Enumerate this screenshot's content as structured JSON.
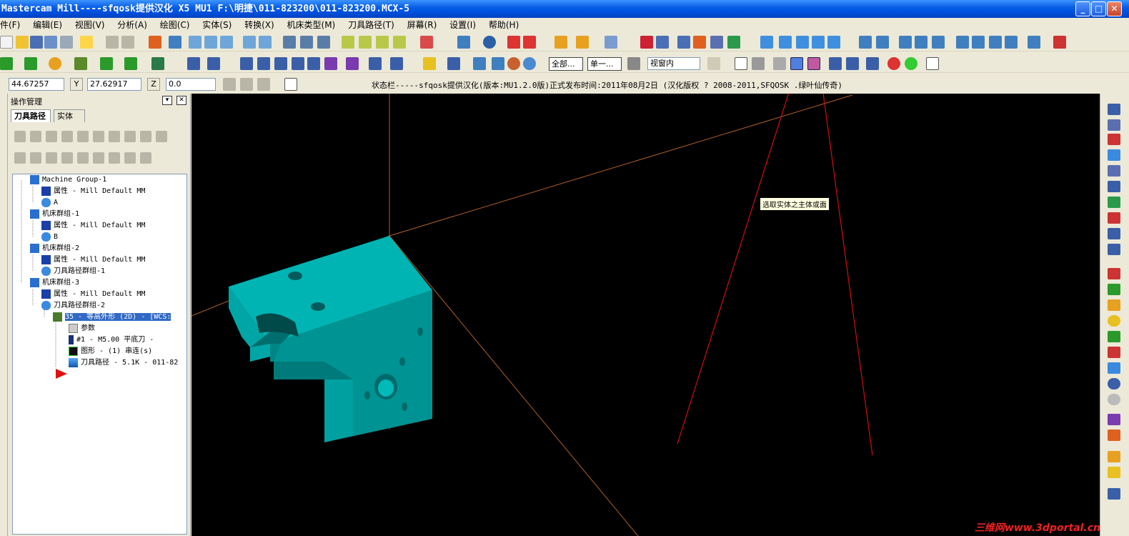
{
  "window": {
    "title": "Mastercam Mill----sfqosk提供汉化 X5 MU1  F:\\明捷\\011-823200\\011-823200.MCX-5",
    "min": "_",
    "max": "□",
    "close": "✕"
  },
  "menu": [
    "件(F)",
    "编辑(E)",
    "视图(V)",
    "分析(A)",
    "绘图(C)",
    "实体(S)",
    "转换(X)",
    "机床类型(M)",
    "刀具路径(T)",
    "屏幕(R)",
    "设置(I)",
    "帮助(H)"
  ],
  "toolbar3": {
    "all_button": "全部...",
    "single_button": "单一...",
    "view_mode": "视窗内"
  },
  "coords": {
    "x_value": "44.67257",
    "y_label": "Y",
    "y_value": "27.62917",
    "z_label": "Z",
    "z_value": "0.0"
  },
  "status_text": "状态栏-----sfqosk提供汉化(版本:MU1.2.0版)正式发布时间:2011年08月2日 (汉化版权 ? 2008-2011,SFQOSK  .绿叶仙传奇)",
  "panel": {
    "title": "操作管理",
    "tabs": [
      "刀具路径",
      "实体"
    ],
    "tree": [
      {
        "text": "Machine Group-1",
        "indent": 0,
        "icon": "machine-group-icon"
      },
      {
        "text": "属性 - Mill Default MM",
        "indent": 1,
        "icon": "properties-icon"
      },
      {
        "text": "A",
        "indent": 1,
        "icon": "toolpath-group-icon"
      },
      {
        "text": "机床群组-1",
        "indent": 0,
        "icon": "machine-group-icon"
      },
      {
        "text": "属性 - Mill Default MM",
        "indent": 1,
        "icon": "properties-icon"
      },
      {
        "text": "B",
        "indent": 1,
        "icon": "toolpath-group-icon"
      },
      {
        "text": "机床群组-2",
        "indent": 0,
        "icon": "machine-group-icon"
      },
      {
        "text": "属性 - Mill Default MM",
        "indent": 1,
        "icon": "properties-icon"
      },
      {
        "text": "刀具路径群组-1",
        "indent": 1,
        "icon": "toolpath-group-icon"
      },
      {
        "text": "机床群组-3",
        "indent": 0,
        "icon": "machine-group-icon"
      },
      {
        "text": "属性 - Mill Default MM",
        "indent": 1,
        "icon": "properties-icon"
      },
      {
        "text": "刀具路径群组-2",
        "indent": 1,
        "icon": "toolpath-group-icon"
      },
      {
        "text": "35 - 等高外形 (2D) - [WCS:",
        "indent": 2,
        "icon": "operation-icon",
        "selected": true
      },
      {
        "text": "参数",
        "indent": 3,
        "icon": "folder-icon"
      },
      {
        "text": "#1 - M5.00 平底刀 -",
        "indent": 3,
        "icon": "tool-icon"
      },
      {
        "text": "图形 - (1) 串连(s)",
        "indent": 3,
        "icon": "geometry-icon"
      },
      {
        "text": "刀具路径 - 5.1K - 011-82",
        "indent": 3,
        "icon": "toolpath-icon"
      }
    ]
  },
  "tooltip": "选取实体之主体或面",
  "watermark": "三维网www.3dportal.cn",
  "colors": {
    "viewport_bg": "#000000",
    "part_color": "#00a8a8",
    "axis_color": "#b0602a",
    "annotation_color": "#d01010"
  }
}
